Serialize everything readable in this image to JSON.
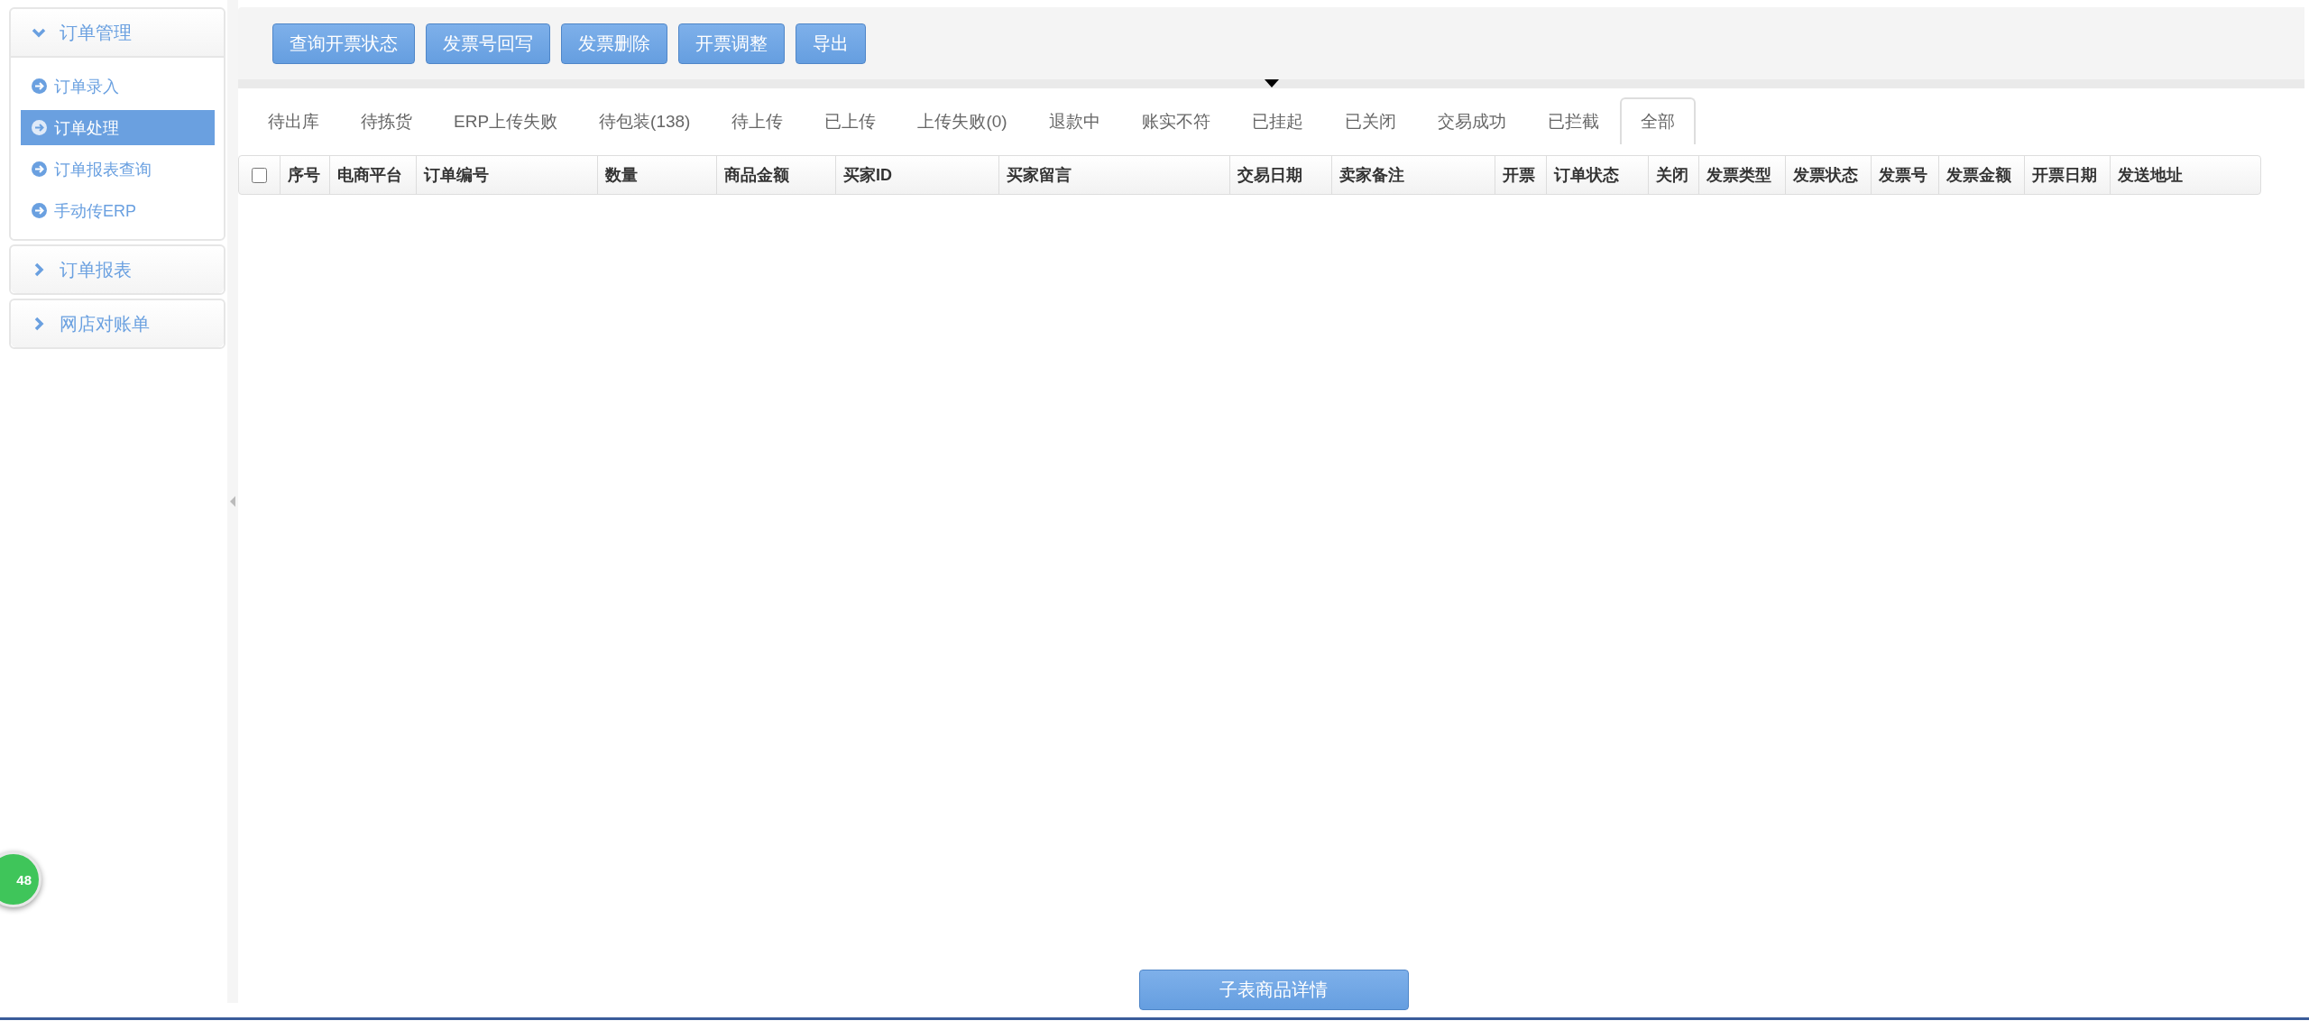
{
  "sidebar": {
    "groups": [
      {
        "title": "订单管理",
        "expanded": true,
        "items": [
          {
            "label": "订单录入",
            "selected": false
          },
          {
            "label": "订单处理",
            "selected": true
          },
          {
            "label": "订单报表查询",
            "selected": false
          },
          {
            "label": "手动传ERP",
            "selected": false
          }
        ]
      },
      {
        "title": "订单报表",
        "expanded": false
      },
      {
        "title": "网店对账单",
        "expanded": false
      }
    ]
  },
  "toolbar": {
    "buttons": [
      "查询开票状态",
      "发票号回写",
      "发票删除",
      "开票调整",
      "导出"
    ]
  },
  "tabs": [
    {
      "label": "待出库",
      "selected": false
    },
    {
      "label": "待拣货",
      "selected": false
    },
    {
      "label": "ERP上传失败",
      "selected": false
    },
    {
      "label": "待包装(138)",
      "selected": false
    },
    {
      "label": "待上传",
      "selected": false
    },
    {
      "label": "已上传",
      "selected": false
    },
    {
      "label": "上传失败(0)",
      "selected": false
    },
    {
      "label": "退款中",
      "selected": false
    },
    {
      "label": "账实不符",
      "selected": false
    },
    {
      "label": "已挂起",
      "selected": false
    },
    {
      "label": "已关闭",
      "selected": false
    },
    {
      "label": "交易成功",
      "selected": false
    },
    {
      "label": "已拦截",
      "selected": false
    },
    {
      "label": "全部",
      "selected": true
    }
  ],
  "table": {
    "select_all_checked": false,
    "columns": [
      "序号",
      "电商平台",
      "订单编号",
      "数量",
      "商品金额",
      "买家ID",
      "买家留言",
      "交易日期",
      "卖家备注",
      "开票",
      "订单状态",
      "关闭",
      "发票类型",
      "发票状态",
      "发票号",
      "发票金额",
      "开票日期",
      "发送地址"
    ]
  },
  "detail_button": "子表商品详情",
  "floating_badge": "48"
}
